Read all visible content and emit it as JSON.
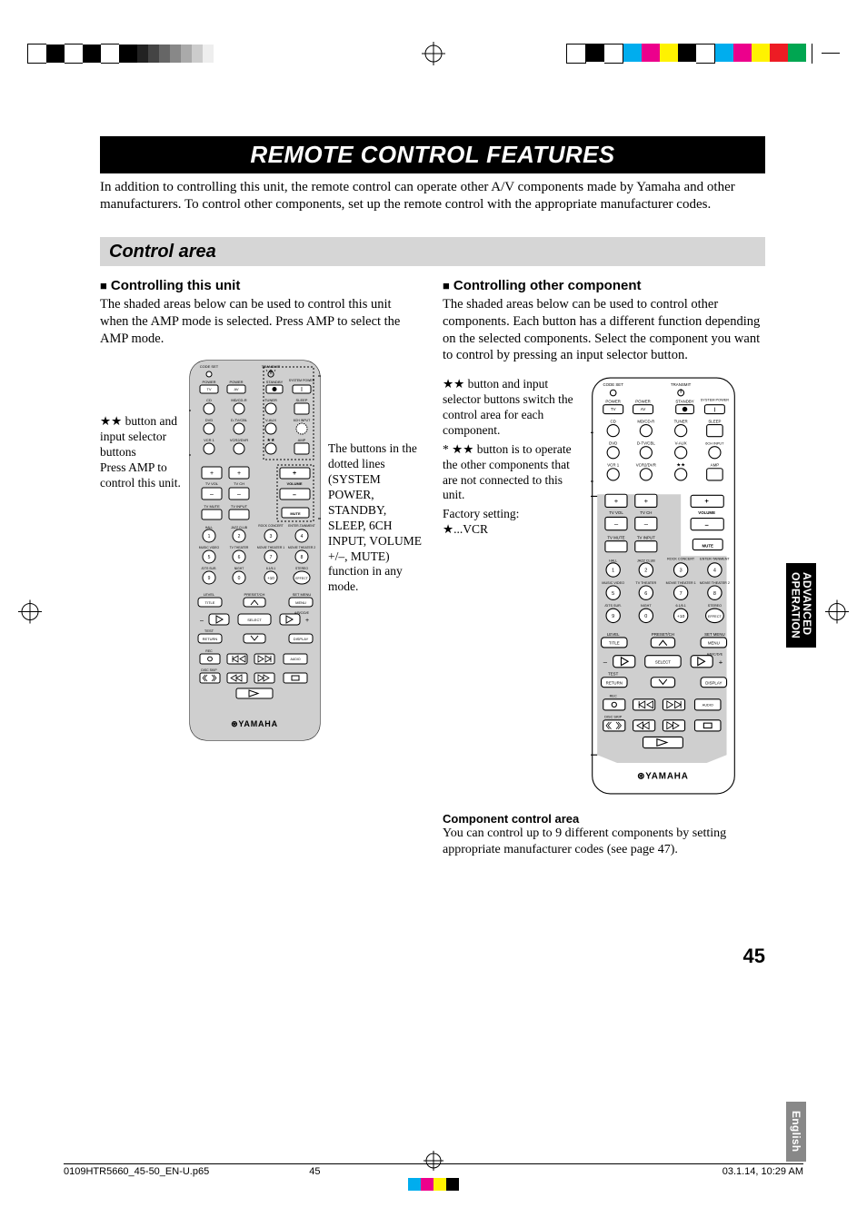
{
  "page_number": "45",
  "title": "REMOTE CONTROL FEATURES",
  "intro": "In addition to controlling this unit, the remote control can operate other A/V components made by Yamaha and other manufacturers. To control other components, set up the remote control with the appropriate manufacturer codes.",
  "section_heading": "Control area",
  "left": {
    "heading": "Controlling this unit",
    "body": "The shaded areas below can be used to control this unit when the AMP mode is selected. Press AMP to select the AMP mode.",
    "callout_left": "★★ button and input selector buttons\nPress AMP to control this unit.",
    "callout_right": "The buttons in the dotted lines (SYSTEM POWER, STANDBY, SLEEP, 6CH INPUT, VOLUME +/–, MUTE) function in any mode."
  },
  "right": {
    "heading": "Controlling other component",
    "body": "The shaded areas below can be used to control other components. Each button has a different function depending on the selected components. Select the component you want to control by pressing an input selector button.",
    "callout_left_1": "★★ button and input selector buttons switch the control area for each component.",
    "callout_left_2": "* ★★ button is to operate the other components that are not connected to this unit.",
    "callout_left_3": "Factory setting:",
    "callout_left_4": "★...VCR",
    "component_caption_title": "Component control area",
    "component_caption_body": "You can control up to 9 different components by setting appropriate manufacturer codes (see page 47)."
  },
  "side_tab_1a": "ADVANCED",
  "side_tab_1b": "OPERATION",
  "side_tab_2": "English",
  "footer": {
    "filename": "0109HTR5660_45-50_EN-U.p65",
    "page": "45",
    "date": "03.1.14, 10:29 AM"
  },
  "remote": {
    "brand": "YAMAHA",
    "top_labels": [
      "CODE SET",
      "TRANSMIT"
    ],
    "row1": [
      "POWER",
      "POWER",
      "STANDBY",
      "SYSTEM POWER"
    ],
    "row1b": [
      "TV",
      "AV"
    ],
    "row2": [
      "CD",
      "MD/CD-R",
      "TUNER",
      "SLEEP"
    ],
    "row3": [
      "DVD",
      "D-TV/CBL",
      "V-AUX",
      "6CH INPUT"
    ],
    "row4": [
      "VCR 1",
      "VCR2/DVR",
      "★★",
      "AMP"
    ],
    "vol_labels": [
      "TV VOL",
      "TV CH",
      "VOLUME"
    ],
    "mute_row": [
      "TV MUTE",
      "TV INPUT",
      "MUTE"
    ],
    "dsp_row1": [
      "HALL",
      "JAZZ CLUB",
      "ROCK CONCERT",
      "ENTER-TAINMENT"
    ],
    "dsp_nums1": [
      "1",
      "2",
      "3",
      "4"
    ],
    "dsp_row2": [
      "MUSIC VIDEO",
      "TV THEATER",
      "MOVIE THEATER 1",
      "MOVIE THEATER 2"
    ],
    "dsp_nums2": [
      "5",
      "6",
      "7",
      "8"
    ],
    "dsp_row3": [
      "/DTS SUR.",
      "NIGHT",
      "6.1/5.1",
      "STEREO"
    ],
    "dsp_nums3": [
      "9",
      "0",
      "+10",
      "EFFECT"
    ],
    "nav_row1": [
      "LEVEL",
      "PRESET/CH",
      "SET MENU"
    ],
    "nav_row1b": [
      "TITLE",
      "MENU"
    ],
    "nav_row2": [
      "SELECT",
      "A/B/C/D/E"
    ],
    "nav_row3": [
      "RETURN",
      "DISPLAY",
      "TEST"
    ],
    "transport_row1": [
      "REC",
      "DISC SKIP",
      "AUDIO"
    ],
    "plus": "+",
    "minus": "–"
  },
  "print_colors": [
    "#00adee",
    "#ec008c",
    "#fff200",
    "#000000",
    "#00adee",
    "#ec008c",
    "#fff200",
    "#ed1c24",
    "#00a651"
  ]
}
